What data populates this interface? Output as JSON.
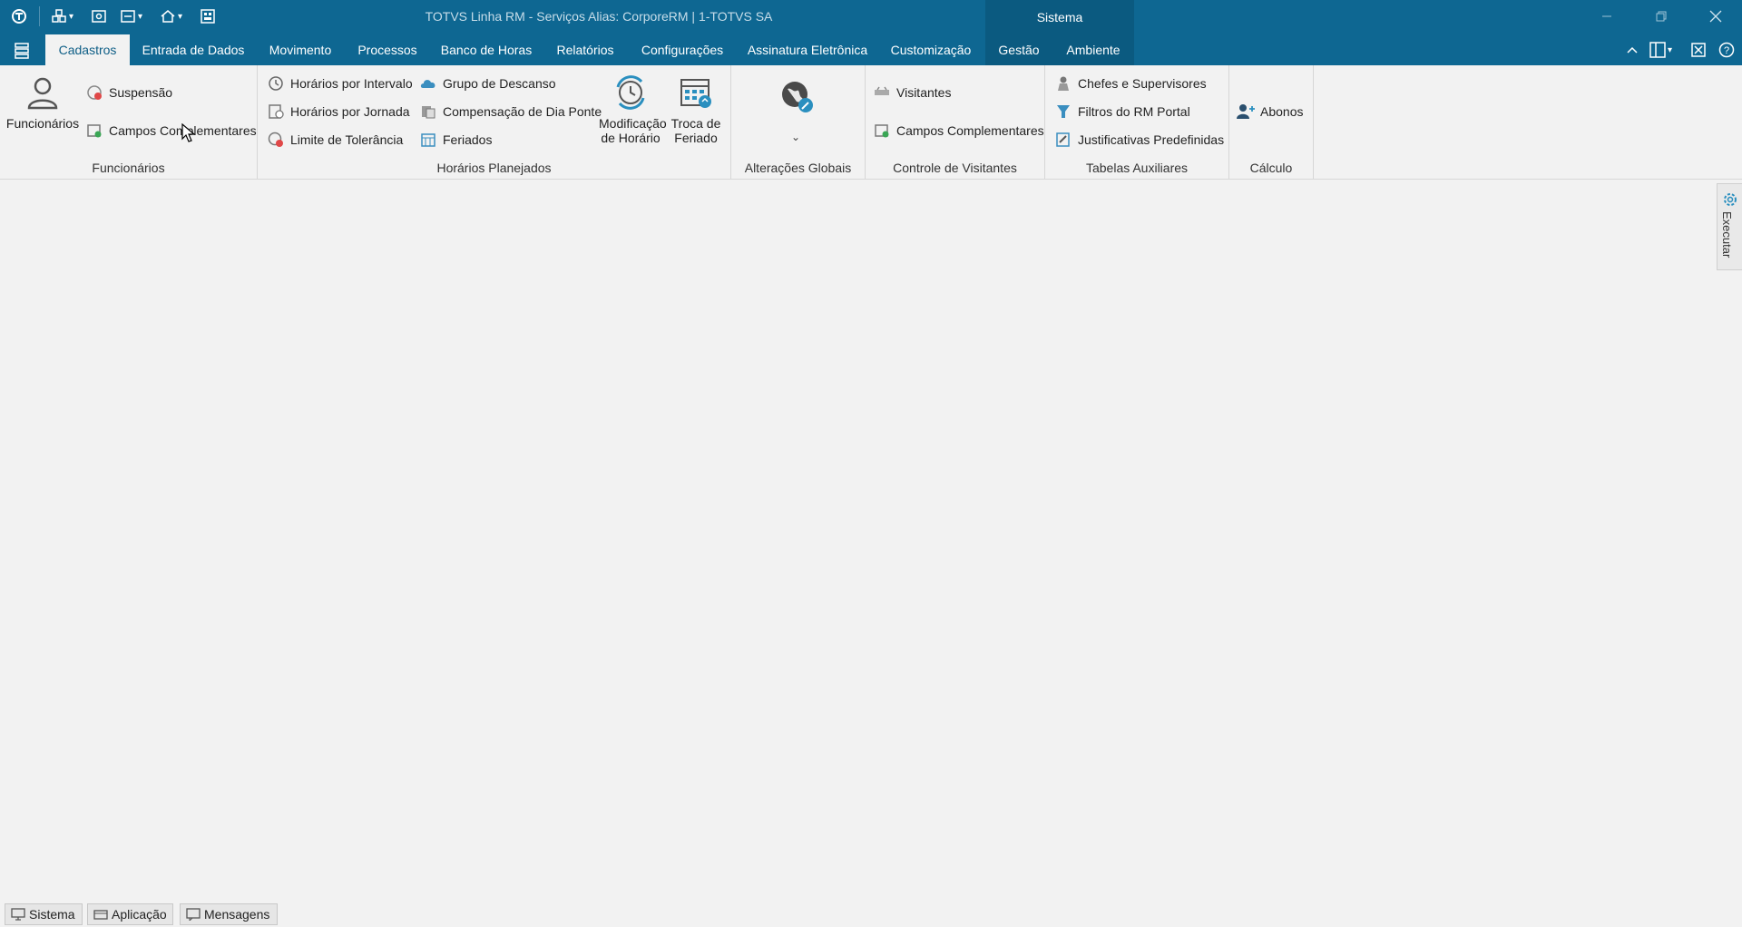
{
  "window": {
    "title": "TOTVS Linha RM - Serviços  Alias: CorporeRM | 1-TOTVS SA",
    "context_tab": "Sistema"
  },
  "tabs": [
    {
      "label": "Cadastros",
      "active": true
    },
    {
      "label": "Entrada de Dados"
    },
    {
      "label": "Movimento"
    },
    {
      "label": "Processos"
    },
    {
      "label": "Banco de Horas"
    },
    {
      "label": "Relatórios"
    },
    {
      "label": "Configurações"
    },
    {
      "label": "Assinatura Eletrônica"
    },
    {
      "label": "Customização"
    },
    {
      "label": "Gestão"
    },
    {
      "label": "Ambiente"
    }
  ],
  "ribbon": {
    "funcionarios": {
      "label": "Funcionários",
      "large": "Funcionários",
      "suspensao": "Suspensão",
      "campos": "Campos Complementares"
    },
    "horarios": {
      "label": "Horários Planejados",
      "intervalo": "Horários por Intervalo",
      "jornada": "Horários por Jornada",
      "tolerancia": "Limite de Tolerância",
      "descanso": "Grupo de Descanso",
      "compensacao": "Compensação de Dia Ponte",
      "feriados": "Feriados",
      "modificacao_1": "Modificação",
      "modificacao_2": "de Horário",
      "troca_1": "Troca de",
      "troca_2": "Feriado"
    },
    "alteracoes": {
      "label": "Alterações Globais"
    },
    "visitantes": {
      "label": "Controle de Visitantes",
      "visitantes": "Visitantes",
      "campos": "Campos Complementares"
    },
    "auxiliares": {
      "label": "Tabelas Auxiliares",
      "chefes": "Chefes e Supervisores",
      "filtros": "Filtros do RM Portal",
      "justificativas": "Justificativas Predefinidas"
    },
    "calculo": {
      "label": "Cálculo",
      "abonos": "Abonos"
    }
  },
  "side_panel": {
    "label": "Executar"
  },
  "statusbar": {
    "sistema": "Sistema",
    "aplicacao": "Aplicação",
    "mensagens": "Mensagens"
  },
  "colors": {
    "titlebar": "#0e6792",
    "context": "#0b5a80",
    "accent": "#2a8fbf"
  }
}
